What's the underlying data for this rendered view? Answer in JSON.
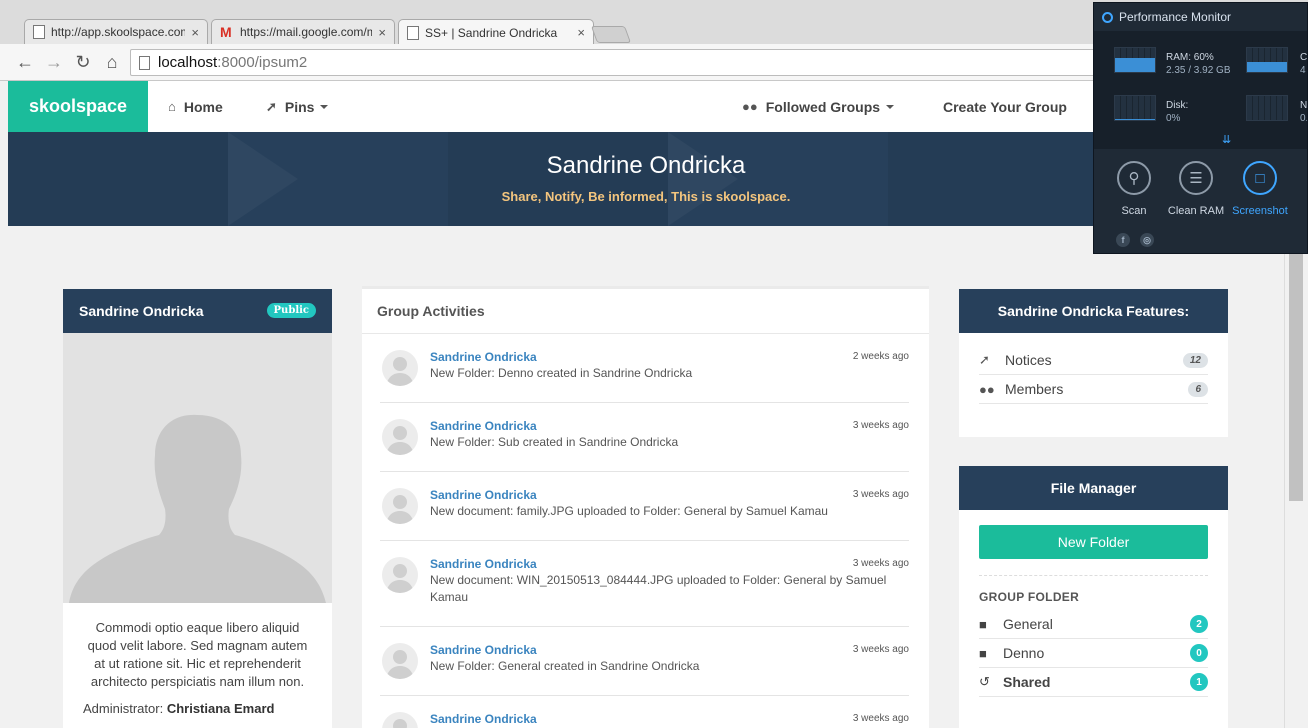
{
  "browser": {
    "tabs": [
      {
        "title": "http://app.skoolspace.com",
        "icon": "page-icon"
      },
      {
        "title": "https://mail.google.com/m",
        "icon": "gmail-icon"
      },
      {
        "title": "SS+ | Sandrine Ondricka",
        "icon": "page-icon"
      }
    ],
    "close_glyph": "×",
    "url_host": "localhost",
    "url_rest": ":8000/ipsum2"
  },
  "nav": {
    "brand": "skoolspace",
    "home": "Home",
    "pins": "Pins",
    "followed_groups": "Followed Groups",
    "create_group": "Create Your Group"
  },
  "banner": {
    "title": "Sandrine Ondricka",
    "subtitle": "Share, Notify, Be informed, This is skoolspace."
  },
  "profile": {
    "name": "Sandrine Ondricka",
    "badge": "Public",
    "description": "Commodi optio eaque libero aliquid quod velit labore. Sed magnam autem at ut ratione sit. Hic et reprehenderit architecto perspiciatis nam illum non.",
    "admin_label": "Administrator:",
    "admin_name": "Christiana Emard"
  },
  "activities": {
    "title": "Group Activities",
    "items": [
      {
        "name": "Sandrine Ondricka",
        "time": "2 weeks ago",
        "text": "New Folder: Denno created in Sandrine Ondricka"
      },
      {
        "name": "Sandrine Ondricka",
        "time": "3 weeks ago",
        "text": "New Folder: Sub created in Sandrine Ondricka"
      },
      {
        "name": "Sandrine Ondricka",
        "time": "3 weeks ago",
        "text": "New document: family.JPG uploaded to Folder: General by Samuel Kamau"
      },
      {
        "name": "Sandrine Ondricka",
        "time": "3 weeks ago",
        "text": "New document: WIN_20150513_084444.JPG uploaded to Folder: General by Samuel Kamau"
      },
      {
        "name": "Sandrine Ondricka",
        "time": "3 weeks ago",
        "text": "New Folder: General created in Sandrine Ondricka"
      },
      {
        "name": "Sandrine Ondricka",
        "time": "3 weeks ago",
        "text": ""
      }
    ]
  },
  "features": {
    "title": "Sandrine Ondricka Features:",
    "items": [
      {
        "label": "Notices",
        "count": "12"
      },
      {
        "label": "Members",
        "count": "6"
      }
    ]
  },
  "file_manager": {
    "title": "File Manager",
    "new_folder": "New Folder",
    "group_folder_label": "GROUP FOLDER",
    "folders": [
      {
        "label": "General",
        "count": "2"
      },
      {
        "label": "Denno",
        "count": "0"
      },
      {
        "label": "Shared",
        "count": "1"
      }
    ]
  },
  "perf_monitor": {
    "title": "Performance Monitor",
    "ram_label": "RAM: 60%",
    "ram_detail": "2.35 / 3.92 GB",
    "ram_level": 0.6,
    "disk_label": "Disk:",
    "disk_detail": "0%",
    "disk_level": 0.0,
    "cpu_label_partial": "Cl",
    "cpu_detail_partial": "4",
    "net_label_partial": "Ne",
    "net_detail_partial": "0.",
    "tools": [
      "Scan",
      "Clean RAM",
      "Screenshot"
    ]
  },
  "colors": {
    "brand": "#1bbc9b",
    "panel_header": "#27405b",
    "link": "#3a84bf",
    "badge_teal": "#22c7c0",
    "banner_sub": "#f3c57e"
  }
}
